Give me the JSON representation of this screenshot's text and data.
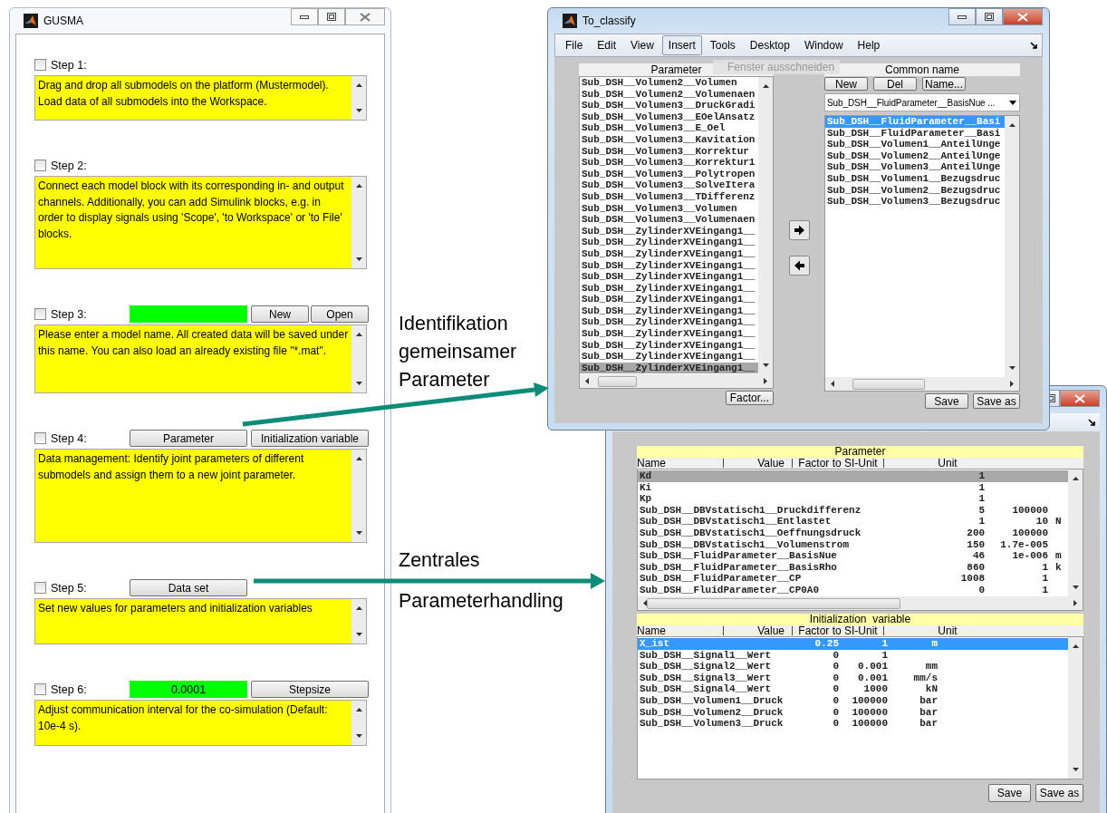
{
  "gusma": {
    "title": "GUSMA",
    "steps": [
      {
        "label": "Step 1:",
        "checked": false,
        "text": "Drag and drop all submodels on the platform (Mustermodel). Load data of all submodels into the Workspace."
      },
      {
        "label": "Step 2:",
        "checked": false,
        "text": "Connect each model block with its corresponding in- and output channels. Additionally, you can add Simulink blocks, e.g. in order to display signals using 'Scope', 'to Workspace' or 'to File' blocks."
      },
      {
        "label": "Step 3:",
        "checked": false,
        "middle": {
          "kind": "field"
        },
        "right": [
          "New",
          "Open"
        ],
        "text": "Please enter a model name. All created data will be saved under this name. You can also load an already existing file \"*.mat\"."
      },
      {
        "label": "Step 4:",
        "checked": false,
        "middle": {
          "kind": "button",
          "label": "Parameter"
        },
        "right": [
          "Initialization variable"
        ],
        "text": "Data management: Identify joint parameters of different submodels and assign them to a new joint parameter."
      },
      {
        "label": "Step 5:",
        "checked": false,
        "middle": {
          "kind": "button",
          "label": "Data set"
        },
        "text": "Set new values for parameters and initialization variables"
      },
      {
        "label": "Step 6:",
        "checked": false,
        "middle": {
          "kind": "field",
          "value": "0.0001"
        },
        "right": [
          "Stepsize"
        ],
        "text": "Adjust communication interval for the co-simulation (Default: 10e-4 s)."
      }
    ]
  },
  "to_classify": {
    "title": "To_classify",
    "menu": [
      {
        "label": "File",
        "selected": false
      },
      {
        "label": "Edit",
        "selected": false
      },
      {
        "label": "View",
        "selected": false
      },
      {
        "label": "Insert",
        "selected": true
      },
      {
        "label": "Tools",
        "selected": false
      },
      {
        "label": "Desktop",
        "selected": false
      },
      {
        "label": "Window",
        "selected": false
      },
      {
        "label": "Help",
        "selected": false
      }
    ],
    "tooltip": "Fenster ausschneiden",
    "parameter_list": {
      "header": "Parameter",
      "focused": false,
      "rows": [
        {
          "text": "Sub_DSH__Volumen2__Volumen",
          "selected": false
        },
        {
          "text": "Sub_DSH__Volumen2__Volumenaen",
          "selected": false
        },
        {
          "text": "Sub_DSH__Volumen3__DruckGradi",
          "selected": false
        },
        {
          "text": "Sub_DSH__Volumen3__EOelAnsatz",
          "selected": false
        },
        {
          "text": "Sub_DSH__Volumen3__E_Oel",
          "selected": false
        },
        {
          "text": "Sub_DSH__Volumen3__Kavitation",
          "selected": false
        },
        {
          "text": "Sub_DSH__Volumen3__Korrektur",
          "selected": false
        },
        {
          "text": "Sub_DSH__Volumen3__Korrektur1",
          "selected": false
        },
        {
          "text": "Sub_DSH__Volumen3__Polytropen",
          "selected": false
        },
        {
          "text": "Sub_DSH__Volumen3__SolveItera",
          "selected": false
        },
        {
          "text": "Sub_DSH__Volumen3__TDifferenz",
          "selected": false
        },
        {
          "text": "Sub_DSH__Volumen3__Volumen",
          "selected": false
        },
        {
          "text": "Sub_DSH__Volumen3__Volumenaen",
          "selected": false
        },
        {
          "text": "Sub_DSH__ZylinderXVEingang1__",
          "selected": false
        },
        {
          "text": "Sub_DSH__ZylinderXVEingang1__",
          "selected": false
        },
        {
          "text": "Sub_DSH__ZylinderXVEingang1__",
          "selected": false
        },
        {
          "text": "Sub_DSH__ZylinderXVEingang1__",
          "selected": false
        },
        {
          "text": "Sub_DSH__ZylinderXVEingang1__",
          "selected": false
        },
        {
          "text": "Sub_DSH__ZylinderXVEingang1__",
          "selected": false
        },
        {
          "text": "Sub_DSH__ZylinderXVEingang1__",
          "selected": false
        },
        {
          "text": "Sub_DSH__ZylinderXVEingang1__",
          "selected": false
        },
        {
          "text": "Sub_DSH__ZylinderXVEingang1__",
          "selected": false
        },
        {
          "text": "Sub_DSH__ZylinderXVEingang1__",
          "selected": false
        },
        {
          "text": "Sub_DSH__ZylinderXVEingang1__",
          "selected": false
        },
        {
          "text": "Sub_DSH__ZylinderXVEingang1__",
          "selected": false
        },
        {
          "text": "Sub_DSH__ZylinderXVEingang1__",
          "selected": true
        }
      ]
    },
    "factor_button": "Factor...",
    "common_name": {
      "header": "Common name",
      "buttons": [
        "New",
        "Del",
        "Name..."
      ],
      "dropdown": "Sub_DSH__FluidParameter__BasisNue ...",
      "focused": true,
      "rows": [
        {
          "text": "Sub_DSH__FluidParameter__Basi",
          "selected": true
        },
        {
          "text": "Sub_DSH__FluidParameter__Basi",
          "selected": false
        },
        {
          "text": "Sub_DSH__Volumen1__AnteilUnge",
          "selected": false
        },
        {
          "text": "Sub_DSH__Volumen2__AnteilUnge",
          "selected": false
        },
        {
          "text": "Sub_DSH__Volumen3__AnteilUnge",
          "selected": false
        },
        {
          "text": "Sub_DSH__Volumen1__Bezugsdruc",
          "selected": false
        },
        {
          "text": "Sub_DSH__Volumen2__Bezugsdruc",
          "selected": false
        },
        {
          "text": "Sub_DSH__Volumen3__Bezugsdruc",
          "selected": false
        }
      ]
    },
    "buttons": [
      "Save",
      "Save as"
    ]
  },
  "data_set_window": {
    "parameter_table": {
      "title": "Parameter",
      "columns": [
        "Name",
        "Value",
        "Factor to SI-Unit",
        "Unit"
      ],
      "focused": false,
      "rows": [
        {
          "name": "Kd",
          "value": "1",
          "selected": true
        },
        {
          "name": "Ki",
          "value": "1",
          "selected": false
        },
        {
          "name": "Kp",
          "value": "1",
          "selected": false
        },
        {
          "name": "Sub_DSH__DBVstatisch1__Druckdifferenz",
          "value": "5",
          "factor": "100000",
          "selected": false
        },
        {
          "name": "Sub_DSH__DBVstatisch1__Entlastet",
          "value": "1",
          "factor": "10",
          "unit": "N",
          "selected": false
        },
        {
          "name": "Sub_DSH__DBVstatisch1__Oeffnungsdruck",
          "value": "200",
          "factor": "100000",
          "selected": false
        },
        {
          "name": "Sub_DSH__DBVstatisch1__Volumenstrom",
          "value": "150",
          "factor": "1.7e-005",
          "selected": false
        },
        {
          "name": "Sub_DSH__FluidParameter__BasisNue",
          "value": "46",
          "factor": "1e-006",
          "unit": "m",
          "selected": false
        },
        {
          "name": "Sub_DSH__FluidParameter__BasisRho",
          "value": "860",
          "factor": "1",
          "unit": "k",
          "selected": false
        },
        {
          "name": "Sub_DSH__FluidParameter__CP",
          "value": "1008",
          "factor": "1",
          "selected": false
        },
        {
          "name": "Sub_DSH__FluidParameter__CP0A0",
          "value": "0",
          "factor": "1",
          "selected": false
        }
      ]
    },
    "init_table": {
      "title": "Initialization  variable",
      "columns": [
        "Name",
        "Value",
        "Factor to SI-Unit",
        "Unit"
      ],
      "focused": true,
      "rows": [
        {
          "name": "X_ist",
          "value": "0.25",
          "factor": "1",
          "unit": "m",
          "selected": true
        },
        {
          "name": "Sub_DSH__Signal1__Wert",
          "value": "0",
          "factor": "1",
          "selected": false
        },
        {
          "name": "Sub_DSH__Signal2__Wert",
          "value": "0",
          "factor": "0.001",
          "unit": "mm",
          "selected": false
        },
        {
          "name": "Sub_DSH__Signal3__Wert",
          "value": "0",
          "factor": "0.001",
          "unit": "mm/s",
          "selected": false
        },
        {
          "name": "Sub_DSH__Signal4__Wert",
          "value": "0",
          "factor": "1000",
          "unit": "kN",
          "selected": false
        },
        {
          "name": "Sub_DSH__Volumen1__Druck",
          "value": "0",
          "factor": "100000",
          "unit": "bar",
          "selected": false
        },
        {
          "name": "Sub_DSH__Volumen2__Druck",
          "value": "0",
          "factor": "100000",
          "unit": "bar",
          "selected": false
        },
        {
          "name": "Sub_DSH__Volumen3__Druck",
          "value": "0",
          "factor": "100000",
          "unit": "bar",
          "selected": false
        }
      ]
    },
    "buttons": [
      "Save",
      "Save as"
    ]
  },
  "annotations": [
    {
      "text": "Identifikation gemeinsamer Parameter"
    },
    {
      "text": "Zentrales"
    },
    {
      "text": "Parameterhandling"
    }
  ]
}
